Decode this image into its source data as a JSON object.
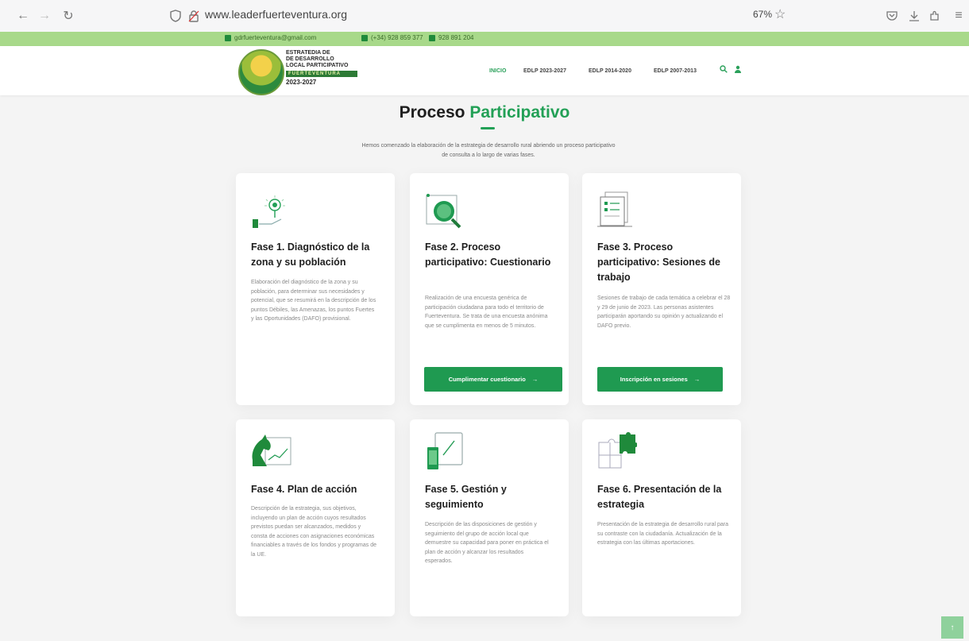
{
  "browser": {
    "url_domain": "www.leaderfuerteventura.org",
    "zoom": "67%"
  },
  "topbar": {
    "email": "gdrfuerteventura@gmail.com",
    "phone1": "(+34) 928 859 377",
    "phone2": "928 891 204"
  },
  "logo": {
    "line1": "ESTRATEDIA DE",
    "line2": "DE DESARROLLO",
    "line3": "LOCAL PARTICIPATIVO",
    "band": "FUERTEVENTURA",
    "year": "2023-2027"
  },
  "nav": {
    "inicio": "INICIO",
    "edlp1": "EDLP 2023-2027",
    "edlp2": "EDLP 2014-2020",
    "edlp3": "EDLP 2007-2013"
  },
  "page": {
    "title_a": "Proceso ",
    "title_b": "Participativo",
    "intro": "Hemos comenzado la elaboración de la estrategia de desarrollo rural abriendo un proceso participativo de consulta a lo largo de varias fases."
  },
  "phases": [
    {
      "title": "Fase 1. Diagnóstico de la zona y su población",
      "text": "Elaboración del diagnóstico de la zona y su población, para determinar sus necesidades y potencial, que se resumirá en la descripción de los puntos Débiles, las Amenazas, los puntos Fuertes y las Oportunidades (DAFO) provisional.",
      "icon": "lightbulb-hand-icon"
    },
    {
      "title": "Fase 2. Proceso participativo: Cuestionario",
      "text": "Realización de una encuesta genérica de participación ciudadana para todo el territorio de Fuerteventura. Se trata de una encuesta anónima que se cumplimenta en menos de 5 minutos.",
      "button": "Cumplimentar cuestionario",
      "icon": "magnifier-icon"
    },
    {
      "title": "Fase 3. Proceso participativo: Sesiones de trabajo",
      "text": "Sesiones de trabajo de cada temática a celebrar el 28 y 29 de junio de 2023. Las personas asistentes participarán aportando su opinión y actualizando el DAFO previo.",
      "button": "Inscripción en sesiones",
      "icon": "document-checklist-icon"
    },
    {
      "title": "Fase 4. Plan de acción",
      "text": "Descripción de la estrategia, sus objetivos, incluyendo un plan de acción cuyos resultados previstos puedan ser alcanzados, medidos y consta de acciones con asignaciones económicas financiables a través de los fondos y programas de la UE.",
      "icon": "chess-knight-icon"
    },
    {
      "title": "Fase 5. Gestión y seguimiento",
      "text": "Descripción de las disposiciones de gestión y seguimiento del grupo de acción local que demuestre su capacidad para poner en práctica el plan de acción y alcanzar los resultados esperados.",
      "icon": "tablet-phone-icon"
    },
    {
      "title": "Fase 6. Presentación de la estrategia",
      "text": "Presentación de la estrategia de desarrollo rural para su contraste con la ciudadanía. Actualización de la estrategia con las últimas aportaciones.",
      "icon": "puzzle-icon"
    }
  ],
  "colors": {
    "accent": "#22a056",
    "button": "#1f9a51",
    "topbar": "#a8d98a"
  }
}
